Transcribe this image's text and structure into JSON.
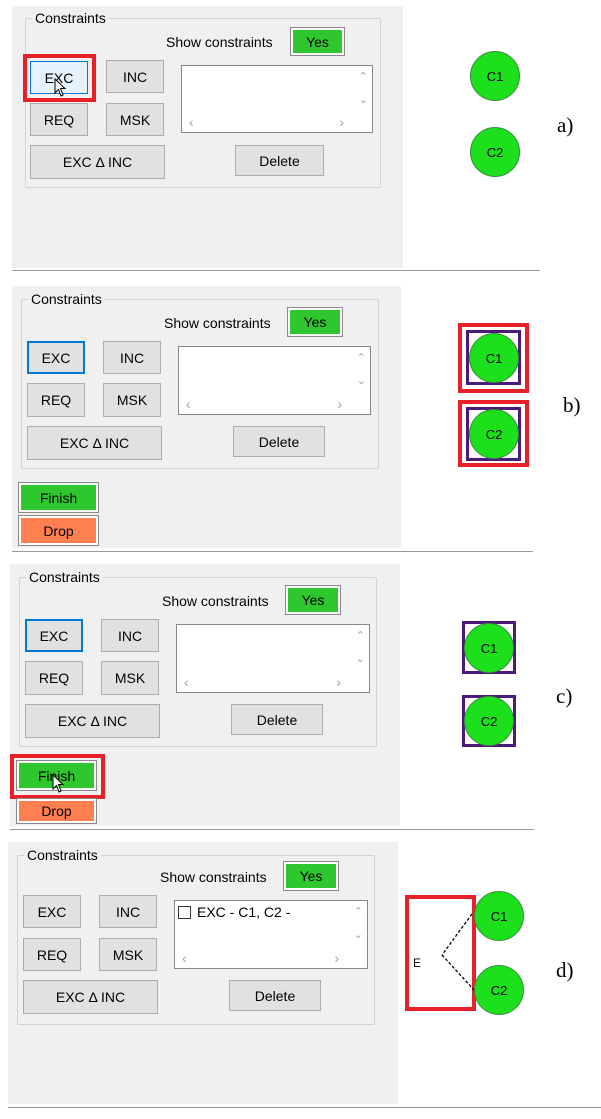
{
  "common": {
    "group_title": "Constraints",
    "show_constraints_label": "Show constraints",
    "yes_label": "Yes",
    "btn_exc": "EXC",
    "btn_inc": "INC",
    "btn_req": "REQ",
    "btn_msk": "MSK",
    "btn_exc_delta_inc": "EXC Δ INC",
    "btn_delete": "Delete",
    "btn_finish": "Finish",
    "btn_drop": "Drop",
    "node_c1": "C1",
    "node_c2": "C2",
    "scroll_up": "⌃",
    "scroll_down": "⌄",
    "scroll_left": "‹",
    "scroll_right": "›"
  },
  "panels": {
    "a": {
      "letter": "a)"
    },
    "b": {
      "letter": "b)"
    },
    "c": {
      "letter": "c)"
    },
    "d": {
      "letter": "d)",
      "list_item": "EXC - C1, C2 -",
      "edge_label": "E"
    }
  },
  "colors": {
    "accent_green": "#2ec82e",
    "node_green": "#1be01b",
    "drop_orange": "#ff7f50",
    "highlight_red": "#e8202a",
    "selection_purple": "#4b1a7a",
    "focus_blue": "#0078d7"
  }
}
